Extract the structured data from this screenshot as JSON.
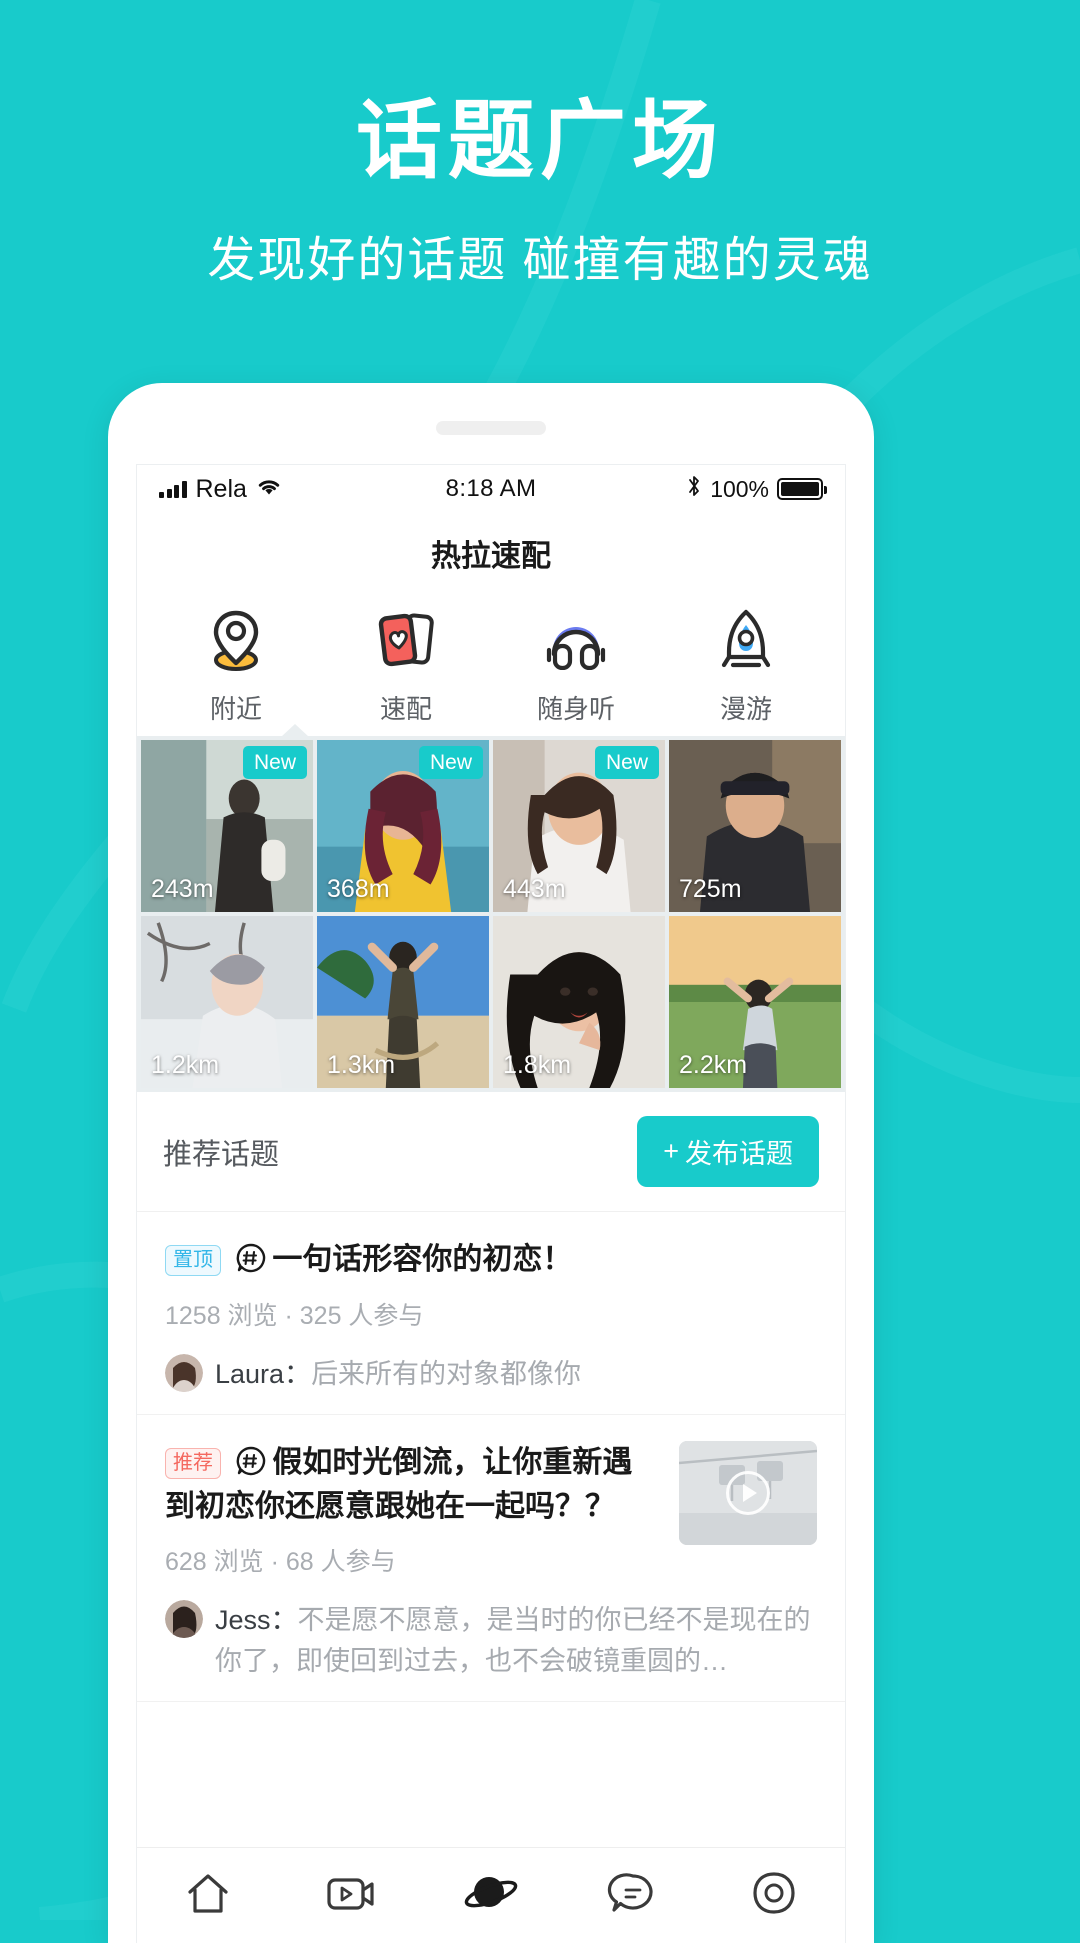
{
  "hero": {
    "title": "话题广场",
    "subtitle": "发现好的话题 碰撞有趣的灵魂"
  },
  "colors": {
    "brand": "#18CBCB",
    "badge_top": "#35b7e8",
    "badge_rec": "#f4685f"
  },
  "statusbar": {
    "carrier": "Rela",
    "time": "8:18 AM",
    "battery_pct": "100%",
    "signal_icon": "signal-bars-icon",
    "wifi_icon": "wifi-icon",
    "bluetooth_icon": "bluetooth-icon",
    "battery_icon": "battery-icon"
  },
  "app": {
    "title": "热拉速配"
  },
  "feature_tabs": [
    {
      "label": "附近",
      "icon": "location-pin-icon",
      "active": true
    },
    {
      "label": "速配",
      "icon": "heart-cards-icon",
      "active": false
    },
    {
      "label": "随身听",
      "icon": "headphones-icon",
      "active": false
    },
    {
      "label": "漫游",
      "icon": "rocket-icon",
      "active": false
    }
  ],
  "photo_grid": [
    {
      "distance": "243m",
      "new": "New"
    },
    {
      "distance": "368m",
      "new": "New"
    },
    {
      "distance": "443m",
      "new": "New"
    },
    {
      "distance": "725m",
      "new": ""
    },
    {
      "distance": "1.2km",
      "new": ""
    },
    {
      "distance": "1.3km",
      "new": ""
    },
    {
      "distance": "1.8km",
      "new": ""
    },
    {
      "distance": "2.2km",
      "new": ""
    }
  ],
  "recommend": {
    "title": "推荐话题",
    "post_button": "发布话题",
    "post_button_plus": "+"
  },
  "topics": [
    {
      "badge": "置顶",
      "badge_type": "top",
      "title": "一句话形容你的初恋！",
      "meta": "1258 浏览 · 325 人参与",
      "comment_user": "Laura：",
      "comment_text": "后来所有的对象都像你",
      "has_thumb": false
    },
    {
      "badge": "推荐",
      "badge_type": "rec",
      "title": "假如时光倒流，让你重新遇到初恋你还愿意跟她在一起吗？？",
      "meta": "628 浏览 · 68 人参与",
      "comment_user": "Jess：",
      "comment_text": "不是愿不愿意，是当时的你已经不是现在的你了，即使回到过去，也不会破镜重圆的…",
      "has_thumb": true
    }
  ],
  "bottom_nav": [
    {
      "icon": "home-icon",
      "active": false
    },
    {
      "icon": "video-icon",
      "active": false
    },
    {
      "icon": "planet-icon",
      "active": true
    },
    {
      "icon": "chat-bubble-icon",
      "active": false
    },
    {
      "icon": "profile-icon",
      "active": false
    }
  ]
}
